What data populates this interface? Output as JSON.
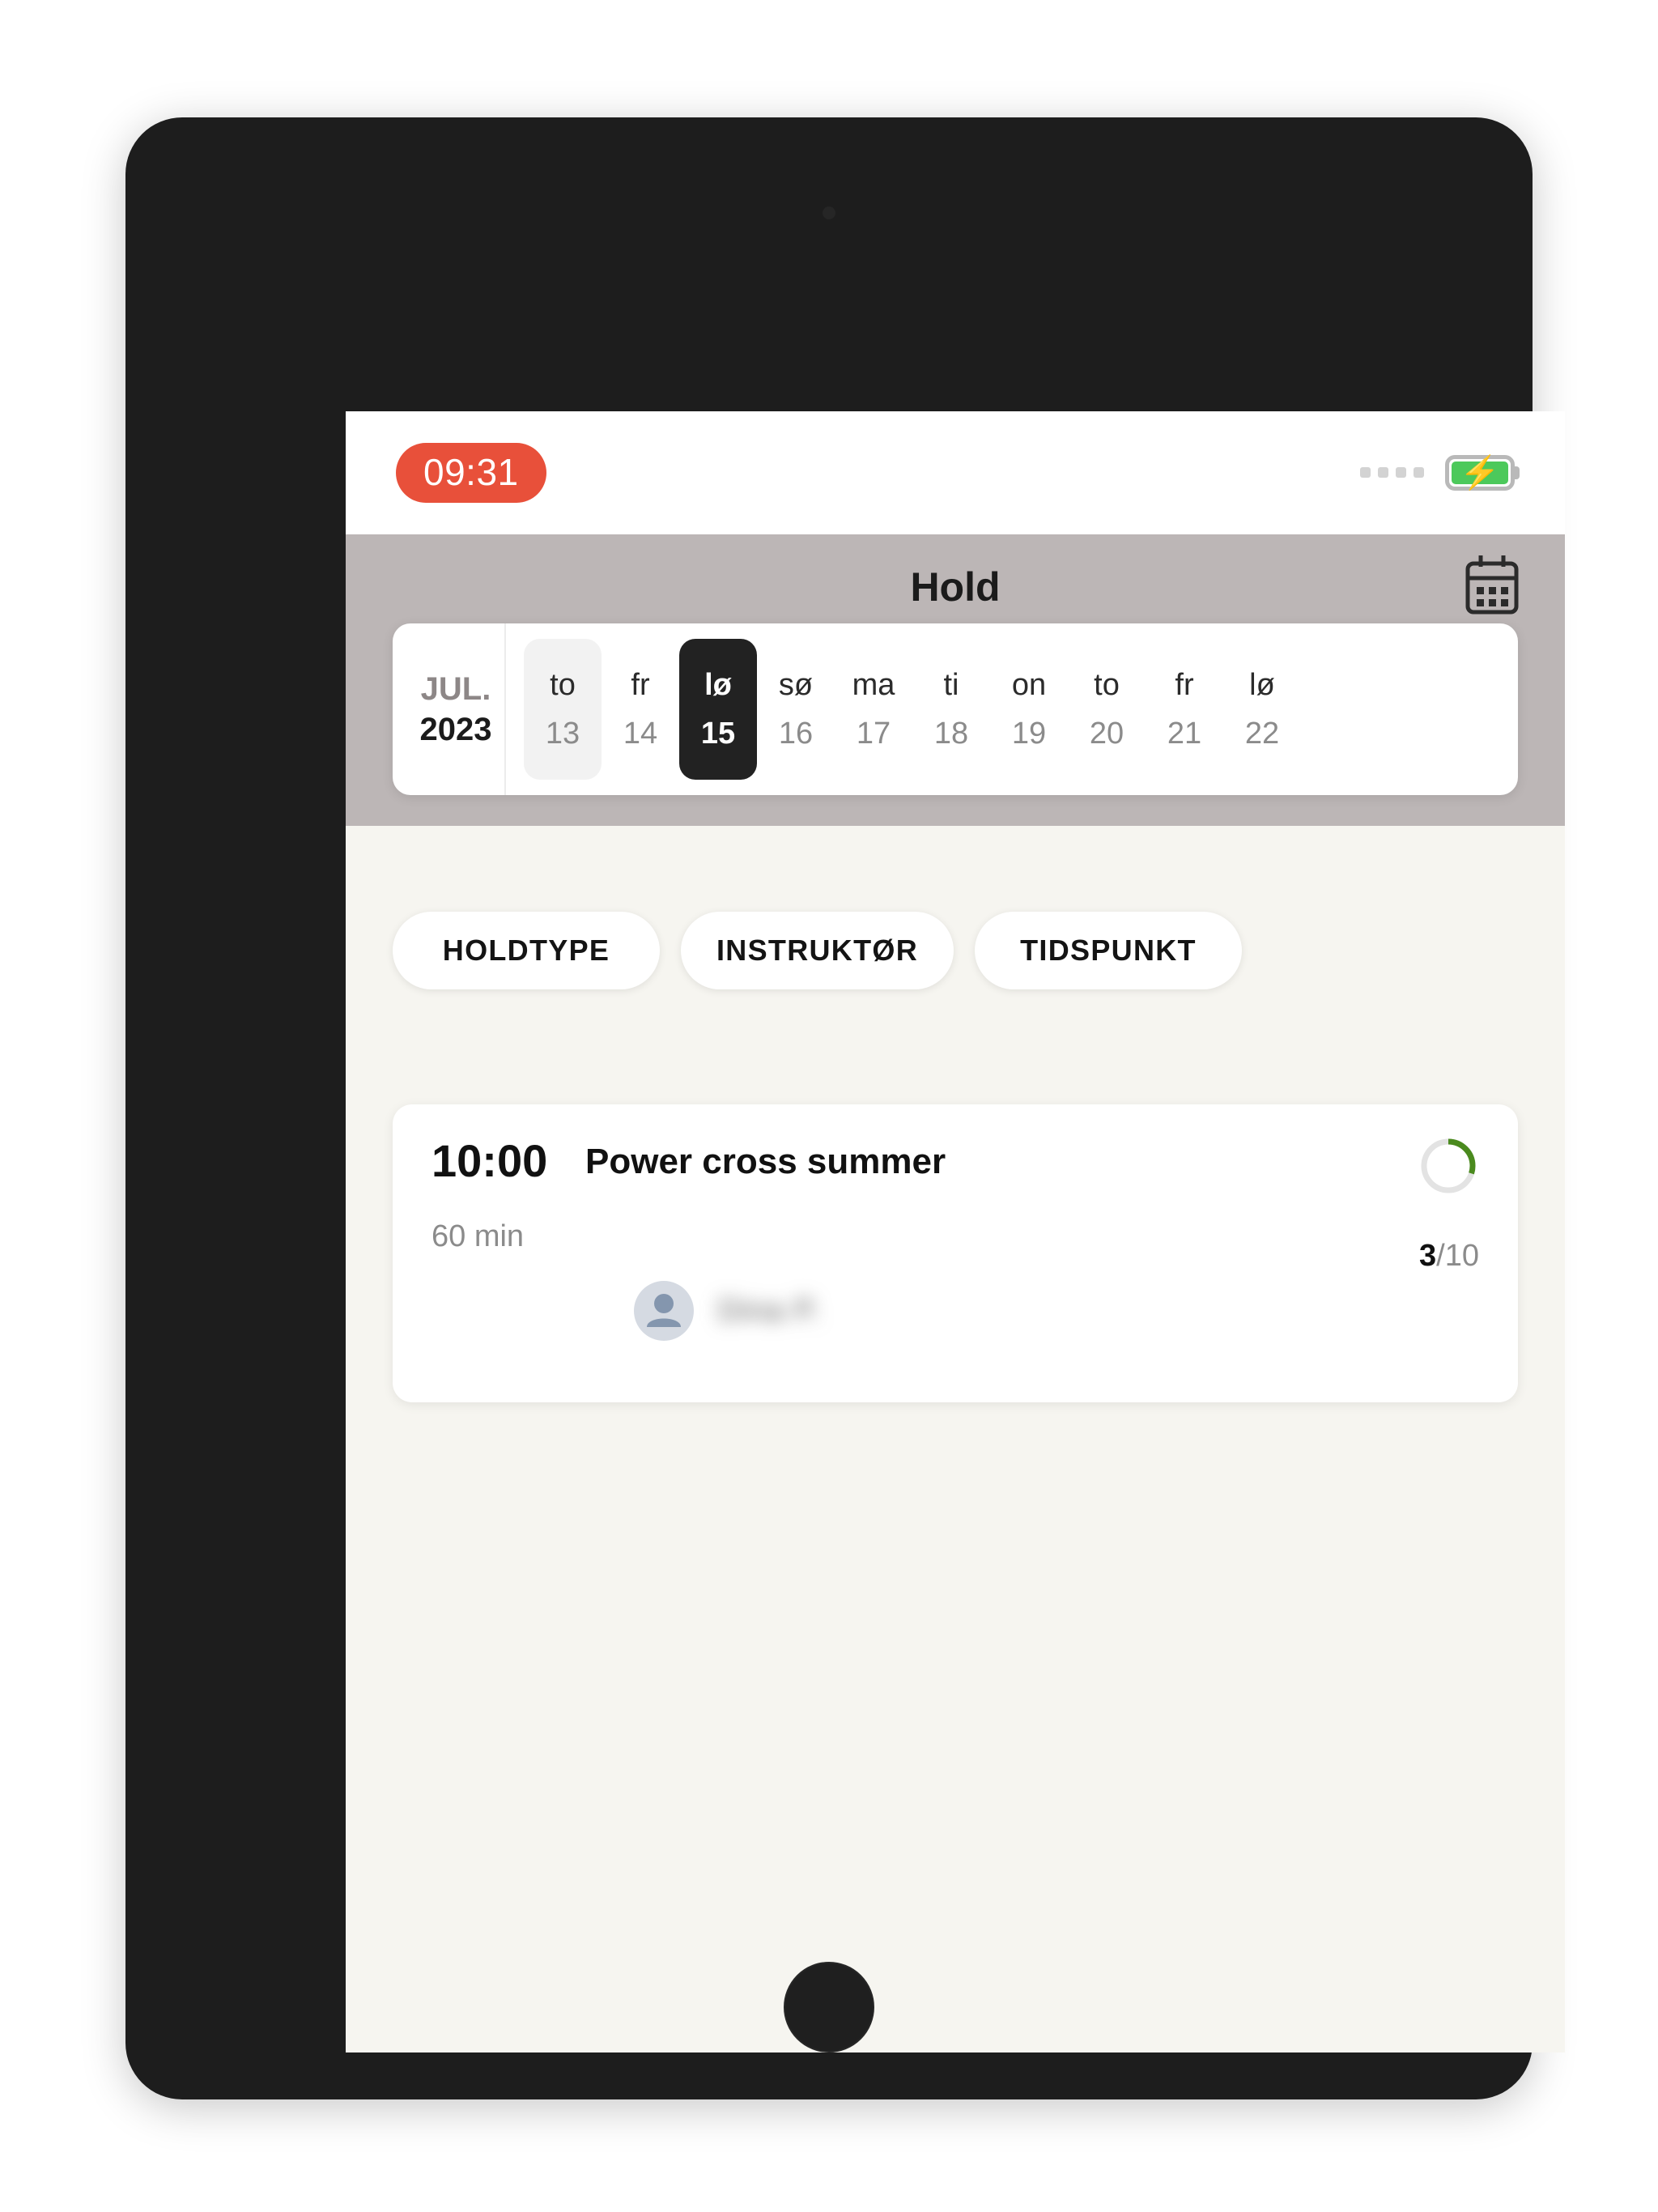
{
  "status_bar": {
    "time": "09:31",
    "signal_dots": 4,
    "battery_icon": "battery-charging-icon",
    "battery_bolt": "⚡",
    "battery_color": "#4cc95b"
  },
  "header": {
    "title": "Hold",
    "calendar_icon": "calendar-icon",
    "background_color": "#bcb6b6"
  },
  "date_strip": {
    "month": "JUL.",
    "year": "2023",
    "selected_day": "15",
    "today": "13",
    "days": [
      {
        "dow": "to",
        "num": "13",
        "state": "today"
      },
      {
        "dow": "fr",
        "num": "14",
        "state": "normal"
      },
      {
        "dow": "lø",
        "num": "15",
        "state": "selected"
      },
      {
        "dow": "sø",
        "num": "16",
        "state": "normal"
      },
      {
        "dow": "ma",
        "num": "17",
        "state": "normal"
      },
      {
        "dow": "ti",
        "num": "18",
        "state": "normal"
      },
      {
        "dow": "on",
        "num": "19",
        "state": "normal"
      },
      {
        "dow": "to",
        "num": "20",
        "state": "normal"
      },
      {
        "dow": "fr",
        "num": "21",
        "state": "normal"
      },
      {
        "dow": "lø",
        "num": "22",
        "state": "normal"
      }
    ]
  },
  "filters": [
    {
      "label": "HOLDTYPE"
    },
    {
      "label": "INSTRUKTØR"
    },
    {
      "label": "TIDSPUNKT"
    }
  ],
  "classes": [
    {
      "time": "10:00",
      "name": "Power cross summer",
      "duration": "60 min",
      "booked": "3",
      "capacity_separator": "/",
      "capacity": "10",
      "capacity_text": "3/10",
      "progress_percent": 30,
      "progress_color": "#4a8a1e",
      "track_color": "#e3e3e3",
      "instructor_name": "Dina P.",
      "instructor_avatar_icon": "person-avatar-icon"
    }
  ],
  "theme": {
    "screen_background": "#f6f5f0",
    "accent_red": "#e8503a",
    "selected_day_background": "#222222",
    "card_background": "#ffffff"
  }
}
